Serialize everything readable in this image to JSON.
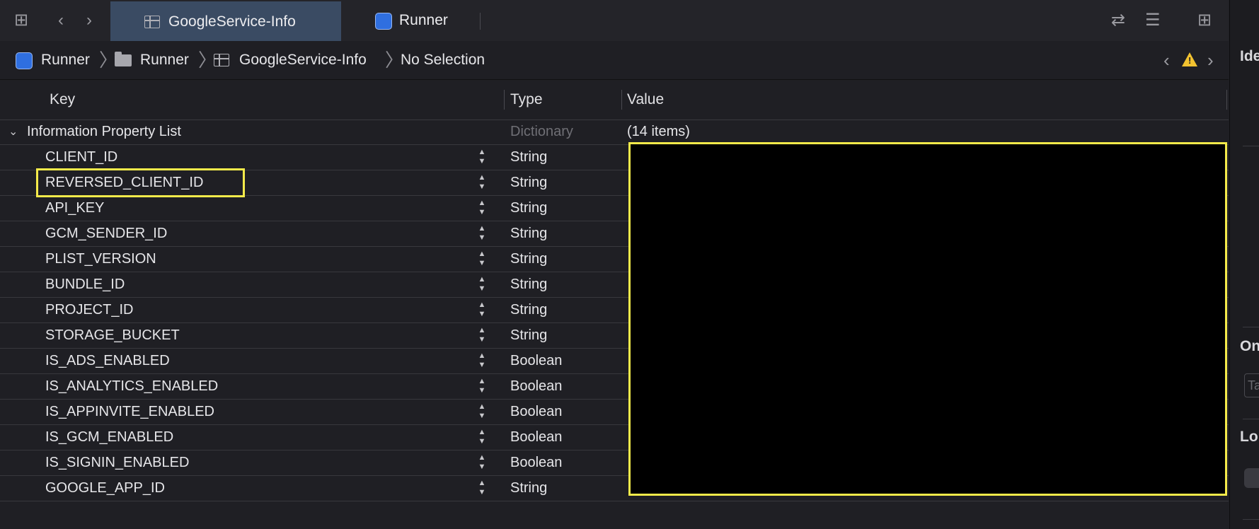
{
  "tabs": [
    {
      "label": "GoogleService-Info",
      "active": true
    },
    {
      "label": "Runner",
      "active": false
    }
  ],
  "breadcrumb": [
    "Runner",
    "Runner",
    "GoogleService-Info",
    "No Selection"
  ],
  "columns": {
    "key": "Key",
    "type": "Type",
    "value": "Value"
  },
  "root": {
    "key": "Information Property List",
    "type": "Dictionary",
    "value": "(14 items)"
  },
  "rows": [
    {
      "key": "CLIENT_ID",
      "type": "String"
    },
    {
      "key": "REVERSED_CLIENT_ID",
      "type": "String"
    },
    {
      "key": "API_KEY",
      "type": "String"
    },
    {
      "key": "GCM_SENDER_ID",
      "type": "String"
    },
    {
      "key": "PLIST_VERSION",
      "type": "String"
    },
    {
      "key": "BUNDLE_ID",
      "type": "String"
    },
    {
      "key": "PROJECT_ID",
      "type": "String"
    },
    {
      "key": "STORAGE_BUCKET",
      "type": "String"
    },
    {
      "key": "IS_ADS_ENABLED",
      "type": "Boolean"
    },
    {
      "key": "IS_ANALYTICS_ENABLED",
      "type": "Boolean"
    },
    {
      "key": "IS_APPINVITE_ENABLED",
      "type": "Boolean"
    },
    {
      "key": "IS_GCM_ENABLED",
      "type": "Boolean"
    },
    {
      "key": "IS_SIGNIN_ENABLED",
      "type": "Boolean"
    },
    {
      "key": "GOOGLE_APP_ID",
      "type": "String"
    }
  ],
  "inspector": {
    "section1": "Ide",
    "section2": "On",
    "field_placeholder": "Ta",
    "section3": "Lo"
  },
  "colors": {
    "highlight": "#f4ea4a",
    "active_tab": "#3a4b63",
    "warning": "#f2c230"
  },
  "icons": {
    "grid": "grid-icon",
    "back": "chevron-left-icon",
    "forward": "chevron-right-icon",
    "plist": "property-list-icon",
    "xcode": "xcode-project-icon",
    "folder": "folder-icon",
    "swap": "swap-arrows-icon",
    "lines": "text-lines-icon",
    "inspector": "add-editor-icon",
    "warning": "warning-icon"
  }
}
